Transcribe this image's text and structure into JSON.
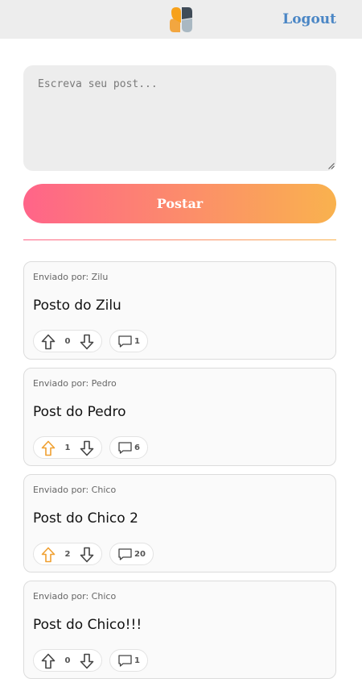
{
  "header": {
    "logo_icon": "app-logo-icon",
    "logout_label": "Logout"
  },
  "composer": {
    "placeholder": "Escreva seu post...",
    "value": ""
  },
  "post_button_label": "Postar",
  "colors": {
    "gradient_start": "#ff6489",
    "gradient_end": "#f9b24e",
    "upvote_active": "#f0a030",
    "logout": "#4a86c5"
  },
  "posts": [
    {
      "author": "Enviado por: Zilu",
      "title": "Posto do Zilu",
      "votes": "0",
      "comments": "1",
      "upvoted": false
    },
    {
      "author": "Enviado por: Pedro",
      "title": "Post do Pedro",
      "votes": "1",
      "comments": "6",
      "upvoted": true
    },
    {
      "author": "Enviado por: Chico",
      "title": "Post do Chico 2",
      "votes": "2",
      "comments": "20",
      "upvoted": true
    },
    {
      "author": "Enviado por: Chico",
      "title": "Post do Chico!!!",
      "votes": "0",
      "comments": "1",
      "upvoted": false
    }
  ]
}
